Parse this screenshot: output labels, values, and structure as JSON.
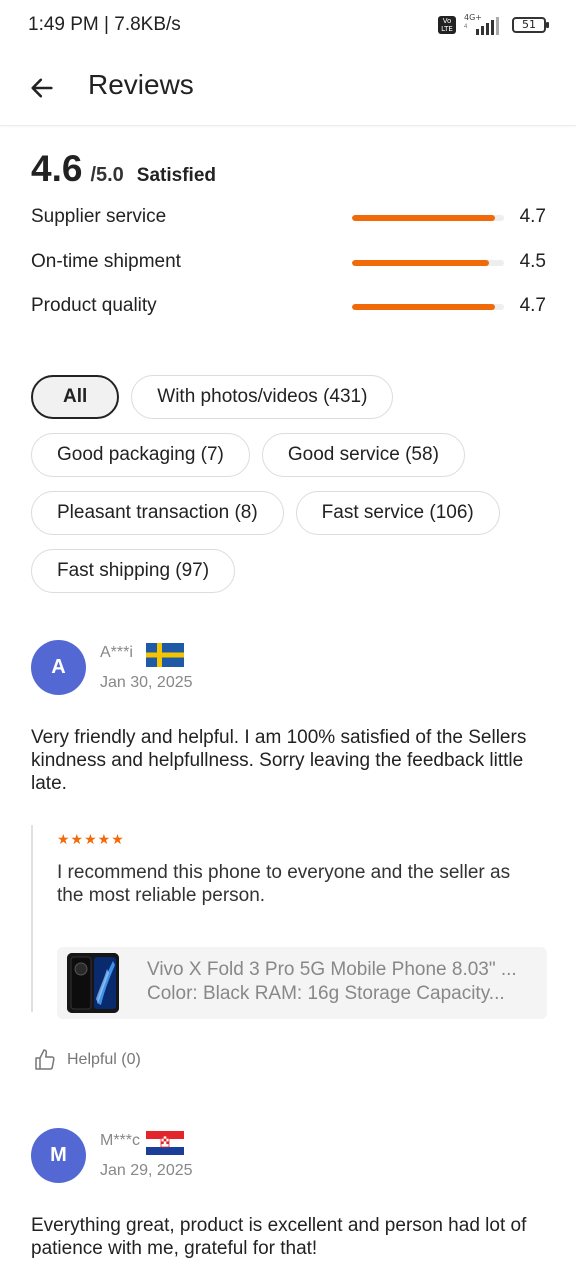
{
  "status_bar": {
    "time": "1:49 PM | 7.8KB/s",
    "network_label": "4G+",
    "network_sub": "4",
    "volte_label": "Vo LTE",
    "battery": "51"
  },
  "header": {
    "title": "Reviews"
  },
  "rating": {
    "score": "4.6",
    "max": "/5.0",
    "label": "Satisfied",
    "metrics": [
      {
        "label": "Supplier service",
        "value": "4.7",
        "fraction": 0.94
      },
      {
        "label": "On-time shipment",
        "value": "4.5",
        "fraction": 0.9
      },
      {
        "label": "Product quality",
        "value": "4.7",
        "fraction": 0.94
      }
    ],
    "accent_color": "#f06a0a"
  },
  "filters": [
    {
      "label": "All",
      "active": true
    },
    {
      "label": "With photos/videos (431)"
    },
    {
      "label": "Good packaging (7)"
    },
    {
      "label": "Good service (58)"
    },
    {
      "label": "Pleasant transaction (8)"
    },
    {
      "label": "Fast service (106)"
    },
    {
      "label": "Fast shipping (97)"
    }
  ],
  "reviews": [
    {
      "initial": "A",
      "name": "A***i",
      "flag": "sweden-flag-icon",
      "date": "Jan 30, 2025",
      "text": "Very friendly and helpful. I am 100% satisfied of the Sellers kindness and helpfullness. Sorry leaving the feedback little late.",
      "followup": {
        "stars": "★★★★★",
        "text": "I recommend this phone to everyone and the seller as the most reliable person.",
        "product_title": "Vivo X Fold 3 Pro 5G Mobile Phone 8.03\" ...",
        "product_variant": "Color: Black RAM: 16g Storage Capacity..."
      },
      "helpful": "Helpful (0)"
    },
    {
      "initial": "M",
      "name": "M***c",
      "flag": "croatia-flag-icon",
      "date": "Jan 29, 2025",
      "text": "Everything great, product is excellent and person had lot of patience with me, grateful for that!"
    }
  ],
  "colors": {
    "avatar": "#5468d4",
    "accent": "#f06a0a"
  }
}
